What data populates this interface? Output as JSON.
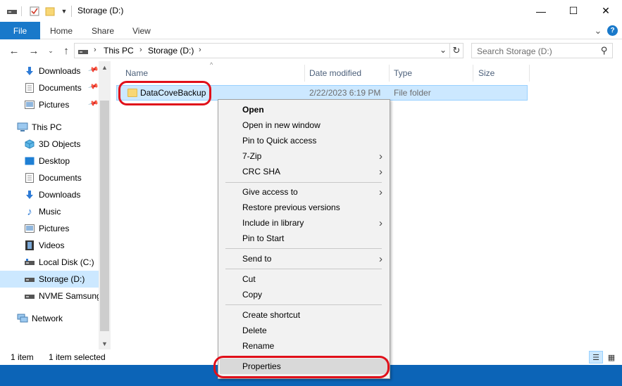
{
  "window": {
    "title": "Storage (D:)",
    "controls": {
      "minimize": "—",
      "maximize": "☐",
      "close": "✕"
    }
  },
  "ribbon": {
    "file_tab": "File",
    "tabs": [
      "Home",
      "Share",
      "View"
    ],
    "collapse_glyph": "⌄",
    "help_glyph": "?"
  },
  "address": {
    "segments": [
      "This PC",
      "Storage (D:)"
    ],
    "search_placeholder": "Search Storage (D:)"
  },
  "nav_pane": {
    "quick_access": [
      {
        "label": "Downloads",
        "icon": "download-arrow-icon"
      },
      {
        "label": "Documents",
        "icon": "document-icon"
      },
      {
        "label": "Pictures",
        "icon": "pictures-icon"
      }
    ],
    "this_pc": "This PC",
    "this_pc_items": [
      {
        "label": "3D Objects",
        "icon": "cube-icon"
      },
      {
        "label": "Desktop",
        "icon": "desktop-icon"
      },
      {
        "label": "Documents",
        "icon": "document-icon"
      },
      {
        "label": "Downloads",
        "icon": "download-arrow-icon"
      },
      {
        "label": "Music",
        "icon": "music-note-icon"
      },
      {
        "label": "Pictures",
        "icon": "pictures-icon"
      },
      {
        "label": "Videos",
        "icon": "film-icon"
      },
      {
        "label": "Local Disk (C:)",
        "icon": "drive-icon"
      },
      {
        "label": "Storage (D:)",
        "icon": "drive-icon",
        "selected": true
      },
      {
        "label": "NVME Samsung",
        "icon": "drive-icon"
      }
    ],
    "network": "Network"
  },
  "file_list": {
    "columns": [
      "Name",
      "Date modified",
      "Type",
      "Size"
    ],
    "rows": [
      {
        "name": "DataCoveBackup",
        "date": "2/22/2023 6:19 PM",
        "type": "File folder",
        "size": ""
      }
    ]
  },
  "status_bar": {
    "count": "1 item",
    "selected": "1 item selected"
  },
  "context_menu": {
    "groups": [
      [
        {
          "label": "Open",
          "bold": true
        },
        {
          "label": "Open in new window"
        },
        {
          "label": "Pin to Quick access"
        },
        {
          "label": "7-Zip",
          "submenu": true
        },
        {
          "label": "CRC SHA",
          "submenu": true
        }
      ],
      [
        {
          "label": "Give access to",
          "submenu": true
        },
        {
          "label": "Restore previous versions"
        },
        {
          "label": "Include in library",
          "submenu": true
        },
        {
          "label": "Pin to Start"
        }
      ],
      [
        {
          "label": "Send to",
          "submenu": true
        }
      ],
      [
        {
          "label": "Cut"
        },
        {
          "label": "Copy"
        }
      ],
      [
        {
          "label": "Create shortcut"
        },
        {
          "label": "Delete"
        },
        {
          "label": "Rename"
        }
      ],
      [
        {
          "label": "Properties",
          "highlighted": true
        }
      ]
    ]
  },
  "colors": {
    "accent": "#1979ca",
    "selection": "#cce8ff",
    "annotation": "#e0101a"
  }
}
